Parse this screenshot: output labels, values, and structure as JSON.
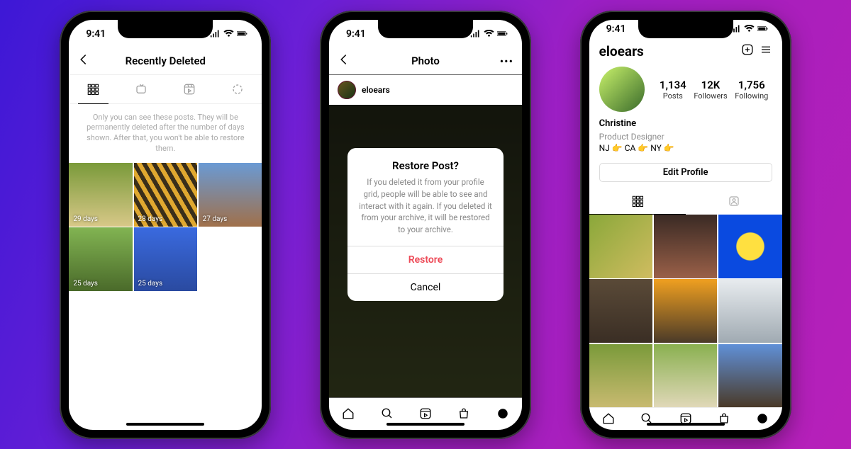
{
  "statusbar": {
    "time": "9:41"
  },
  "phone1": {
    "title": "Recently Deleted",
    "info": "Only you can see these posts. They will be permanently deleted after the number of days shown. After that, you won't be able to restore them.",
    "thumbs": [
      "29 days",
      "28 days",
      "27 days",
      "25 days",
      "25 days"
    ]
  },
  "phone2": {
    "title": "Photo",
    "username": "eloears",
    "dialog": {
      "title": "Restore Post?",
      "body": "If you deleted it from your profile grid, people will be able to see and interact with it again. If you deleted it from your archive, it will be restored to your archive.",
      "restore": "Restore",
      "cancel": "Cancel"
    }
  },
  "phone3": {
    "username": "eloears",
    "stats": {
      "posts_n": "1,134",
      "posts_l": "Posts",
      "followers_n": "12K",
      "followers_l": "Followers",
      "following_n": "1,756",
      "following_l": "Following"
    },
    "name": "Christine",
    "title": "Product Designer",
    "location": "NJ 👉 CA 👉 NY 👉",
    "edit": "Edit Profile"
  }
}
